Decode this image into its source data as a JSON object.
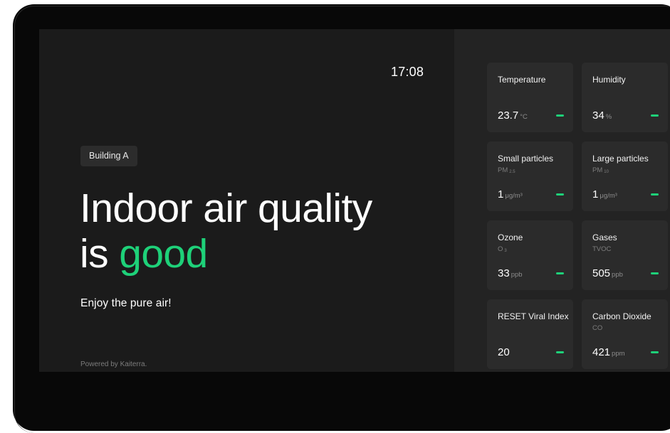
{
  "header": {
    "time": "17:08"
  },
  "hero": {
    "building_label": "Building A",
    "headline_line1": "Indoor air quality",
    "headline_is": "is",
    "headline_status": "good",
    "tagline": "Enjoy the pure air!",
    "powered_by": "Powered by Kaiterra."
  },
  "colors": {
    "accent_green": "#1ed179",
    "background": "#1b1b1b",
    "card_background": "#2b2b2b"
  },
  "metrics": [
    {
      "title": "Temperature",
      "subtitle": "",
      "subscript": "",
      "value": "23.7",
      "unit": "°C",
      "status_icon": "green-dash-icon"
    },
    {
      "title": "Humidity",
      "subtitle": "",
      "subscript": "",
      "value": "34",
      "unit": "%",
      "status_icon": "green-dash-icon"
    },
    {
      "title": "Small particles",
      "subtitle": "PM",
      "subscript": "2.5",
      "value": "1",
      "unit": "μg/m³",
      "status_icon": "green-dash-icon"
    },
    {
      "title": "Large particles",
      "subtitle": "PM",
      "subscript": "10",
      "value": "1",
      "unit": "μg/m³",
      "status_icon": "green-dash-icon"
    },
    {
      "title": "Ozone",
      "subtitle": "O",
      "subscript": "3",
      "value": "33",
      "unit": "ppb",
      "status_icon": "green-dash-icon"
    },
    {
      "title": "Gases",
      "subtitle": "TVOC",
      "subscript": "",
      "value": "505",
      "unit": "ppb",
      "status_icon": "green-dash-icon"
    },
    {
      "title": "RESET Viral Index",
      "subtitle": "",
      "subscript": "",
      "value": "20",
      "unit": "",
      "status_icon": "green-dash-icon"
    },
    {
      "title": "Carbon Dioxide",
      "subtitle": "CO",
      "subscript": "",
      "value": "421",
      "unit": "ppm",
      "status_icon": "green-dash-icon"
    }
  ]
}
